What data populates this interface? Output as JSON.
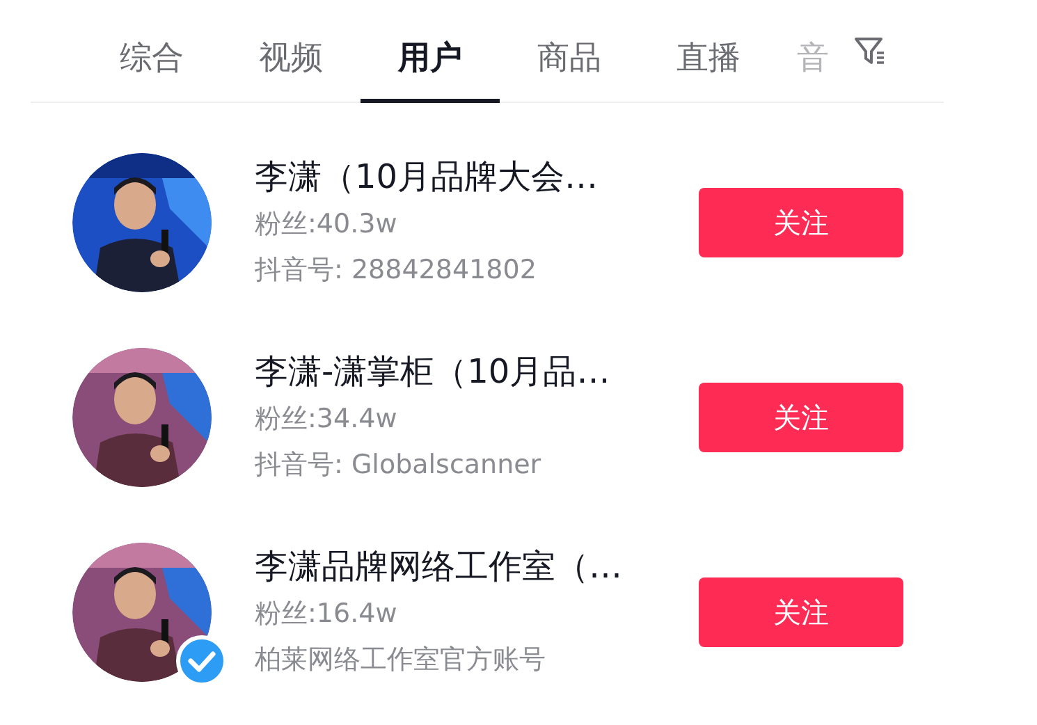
{
  "tabs": [
    {
      "label": "综合",
      "selected": false,
      "faded": false
    },
    {
      "label": "视频",
      "selected": false,
      "faded": false
    },
    {
      "label": "用户",
      "selected": true,
      "faded": false
    },
    {
      "label": "商品",
      "selected": false,
      "faded": false
    },
    {
      "label": "直播",
      "selected": false,
      "faded": false
    },
    {
      "label": "音",
      "selected": false,
      "faded": true
    }
  ],
  "users": [
    {
      "name": "李潇（10月品牌大会…",
      "followers": "粉丝:40.3w",
      "detail": "抖音号: 28842841802",
      "verified": false,
      "button": "关注"
    },
    {
      "name": "李潇-潇掌柜（10月品…",
      "followers": "粉丝:34.4w",
      "detail": "抖音号: Globalscanner",
      "verified": false,
      "button": "关注"
    },
    {
      "name": "李潇品牌网络工作室（…",
      "followers": "粉丝:16.4w",
      "detail": "柏莱网络工作室官方账号",
      "verified": true,
      "button": "关注"
    }
  ]
}
